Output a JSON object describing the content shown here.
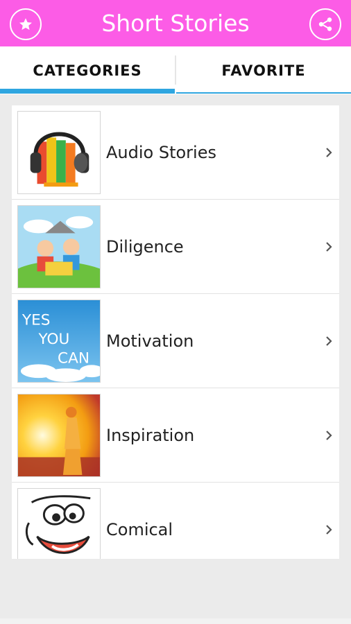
{
  "header": {
    "title": "Short Stories",
    "background_color": "#fc5ce6",
    "left_icon": "star-icon",
    "right_icon": "share-icon"
  },
  "tabs": [
    {
      "label": "CATEGORIES",
      "selected": true
    },
    {
      "label": "FAVORITE",
      "selected": false
    }
  ],
  "accent_color": "#2fa6e0",
  "categories": [
    {
      "label": "Audio Stories",
      "icon": "headphones-books-icon"
    },
    {
      "label": "Diligence",
      "icon": "kids-reading-icon"
    },
    {
      "label": "Motivation",
      "icon": "yes-you-can-icon"
    },
    {
      "label": "Inspiration",
      "icon": "sunrise-woman-icon"
    },
    {
      "label": "Comical",
      "icon": "cartoon-face-icon"
    }
  ],
  "thumbnail_texts": {
    "motivation": [
      "YES",
      "YOU",
      "CAN"
    ]
  }
}
